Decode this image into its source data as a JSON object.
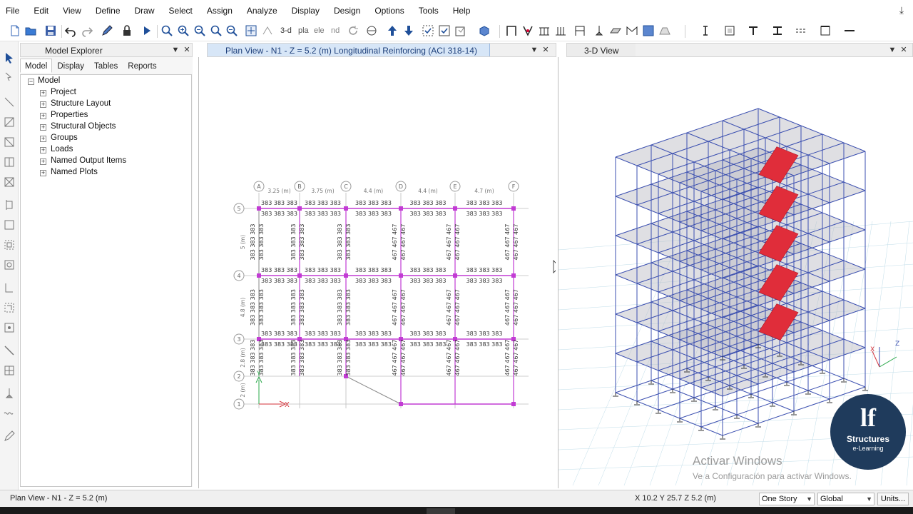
{
  "menu": [
    "File",
    "Edit",
    "View",
    "Define",
    "Draw",
    "Select",
    "Assign",
    "Analyze",
    "Display",
    "Design",
    "Options",
    "Tools",
    "Help"
  ],
  "toolbar": {
    "view_3d": "3-d",
    "view_pla": "pla",
    "view_ele": "ele",
    "view_nd": "nd"
  },
  "explorer": {
    "title": "Model Explorer",
    "tabs": [
      "Model",
      "Display",
      "Tables",
      "Reports"
    ],
    "root": "Model",
    "items": [
      "Project",
      "Structure Layout",
      "Properties",
      "Structural Objects",
      "Groups",
      "Loads",
      "Named Output Items",
      "Named Plots"
    ]
  },
  "plan": {
    "title": "Plan View - N1 - Z = 5.2 (m)  Longitudinal Reinforcing  (ACI 318-14)",
    "grid_x": [
      "A",
      "B",
      "C",
      "D",
      "E",
      "F"
    ],
    "grid_y": [
      "5",
      "4",
      "3",
      "2",
      "1"
    ],
    "spans_x": [
      "3.25 (m)",
      "3.75 (m)",
      "4.4 (m)",
      "4.4 (m)",
      "4.7 (m)"
    ],
    "spans_y": [
      "5 (m)",
      "4.8 (m)",
      "2.8 (m)",
      "2 (m)"
    ],
    "axis_x_label": "X",
    "axis_y_label": "Y"
  },
  "view3d": {
    "title": "3-D View"
  },
  "status": {
    "left": "Plan View - N1 - Z = 5.2 (m)",
    "coords": "X 10.2  Y 25.7  Z 5.2 (m)",
    "story_combo": "One Story",
    "global_combo": "Global",
    "units_button": "Units..."
  },
  "watermark": {
    "line1": "Activar Windows",
    "line2": "Ve a Configuración para activar Windows."
  },
  "logo": {
    "mark": "lf",
    "name": "Structures",
    "tagline": "e-Learning"
  },
  "colors": {
    "frame_blue": "#3b4fb0",
    "column_magenta": "#c23bd4",
    "stair_red": "#e02d3a",
    "logo_bg": "#1f3b5c"
  }
}
